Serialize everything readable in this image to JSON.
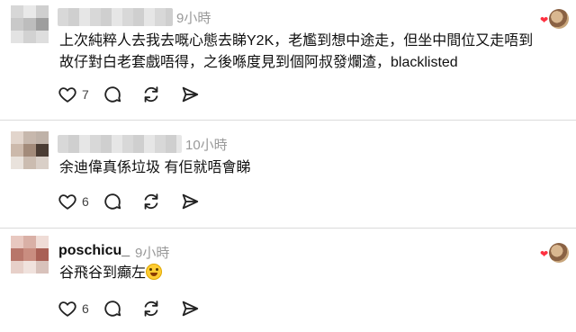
{
  "comments": [
    {
      "username": "",
      "time": "9小時",
      "text_lines": [
        "上次純粹人去我去嘅心態去睇Y2K，老尷到想中途走，但坐中間位又走唔到",
        "故仔對白老套戲唔得，之後喺度見到個阿叔發爛渣，blacklisted"
      ],
      "like_count": "7",
      "author_liked": true
    },
    {
      "username": "",
      "time": "10小時",
      "text_lines": [
        "余迪偉真係垃圾 有佢就唔會睇"
      ],
      "like_count": "6",
      "author_liked": false
    },
    {
      "username": "poschicu_",
      "time": "9小時",
      "text_lines": [
        "谷飛谷到癲左"
      ],
      "emoji": "rolling-on-floor-laughing-emoji",
      "like_count": "6",
      "author_liked": true
    }
  ],
  "icons": [
    "heart-icon",
    "reply-icon",
    "repost-icon",
    "share-icon"
  ],
  "colors": {
    "liked_heart": "#ff3040",
    "meta_gray": "#999999",
    "divider": "#dbdbdb"
  }
}
